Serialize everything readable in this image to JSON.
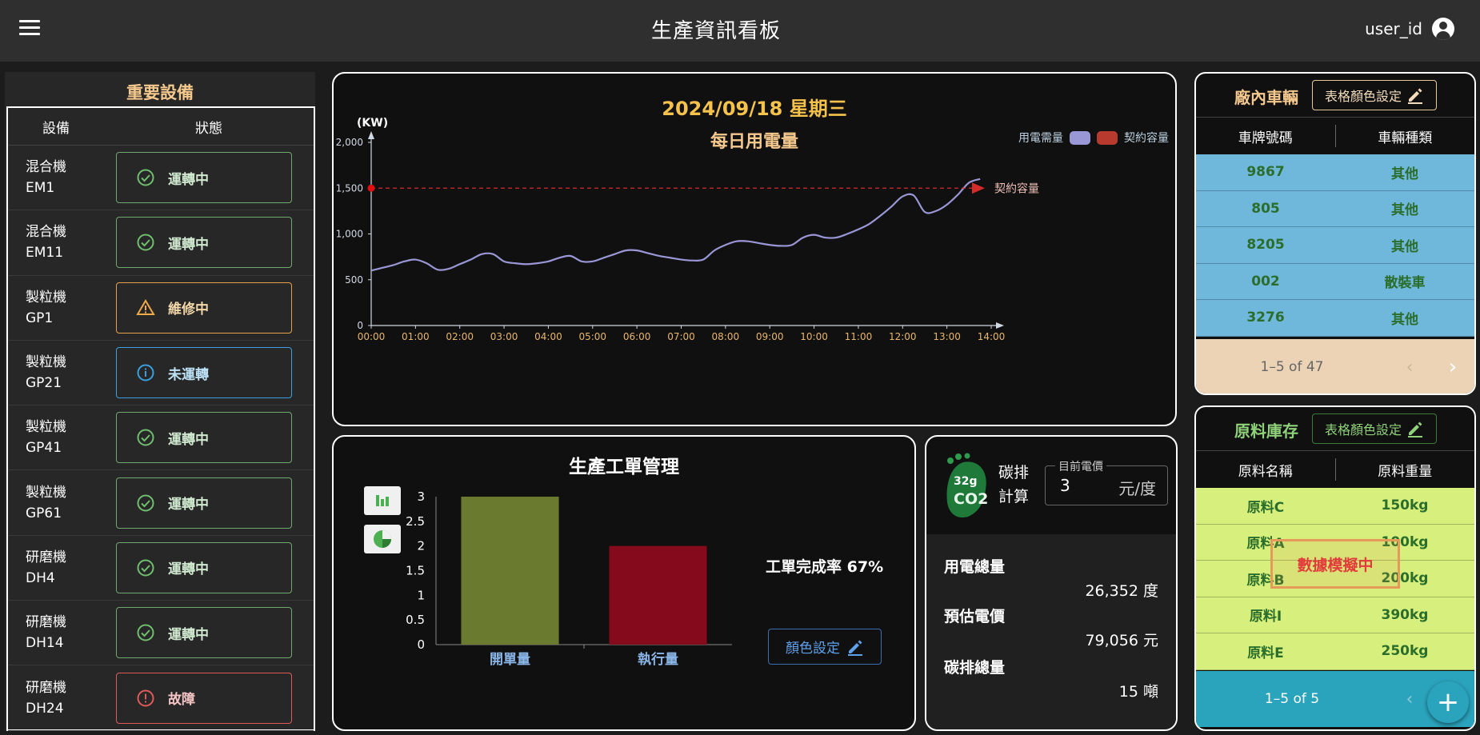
{
  "header": {
    "title": "生產資訊看板",
    "user": "user_id"
  },
  "equipment": {
    "title": "重要設備",
    "col_equipment": "設備",
    "col_status": "狀態",
    "items": [
      {
        "type": "混合機",
        "code": "EM1",
        "status": "運轉中",
        "kind": "ok"
      },
      {
        "type": "混合機",
        "code": "EM11",
        "status": "運轉中",
        "kind": "ok"
      },
      {
        "type": "製粒機",
        "code": "GP1",
        "status": "維修中",
        "kind": "warn"
      },
      {
        "type": "製粒機",
        "code": "GP21",
        "status": "未運轉",
        "kind": "info"
      },
      {
        "type": "製粒機",
        "code": "GP41",
        "status": "運轉中",
        "kind": "ok"
      },
      {
        "type": "製粒機",
        "code": "GP61",
        "status": "運轉中",
        "kind": "ok"
      },
      {
        "type": "研磨機",
        "code": "DH4",
        "status": "運轉中",
        "kind": "ok"
      },
      {
        "type": "研磨機",
        "code": "DH14",
        "status": "運轉中",
        "kind": "ok"
      },
      {
        "type": "研磨機",
        "code": "DH24",
        "status": "故障",
        "kind": "err"
      }
    ]
  },
  "power": {
    "date": "2024/09/18 星期三",
    "title": "每日用電量",
    "legend": [
      {
        "label": "用電需量",
        "color": "#9a97d6"
      },
      {
        "label": "契約容量",
        "color": "#b83a2e"
      }
    ],
    "contract_label": "契約容量",
    "chart_data": {
      "type": "line",
      "ylabel": "(KW)",
      "ylim": [
        0,
        2000
      ],
      "yticks": [
        "0",
        "500",
        "1,000",
        "1,500",
        "2,000"
      ],
      "xticks": [
        "00:00",
        "01:00",
        "02:00",
        "03:00",
        "04:00",
        "05:00",
        "06:00",
        "07:00",
        "08:00",
        "09:00",
        "10:00",
        "11:00",
        "12:00",
        "13:00",
        "14:00"
      ],
      "contract_capacity": 1500,
      "series": [
        {
          "name": "用電需量",
          "x": [
            0,
            0.25,
            0.5,
            0.75,
            1,
            1.25,
            1.5,
            1.75,
            2,
            2.25,
            2.5,
            2.75,
            3,
            3.25,
            3.5,
            3.75,
            4,
            4.25,
            4.5,
            4.75,
            5,
            5.25,
            5.5,
            5.75,
            6,
            6.25,
            6.5,
            6.75,
            7,
            7.25,
            7.5,
            7.75,
            8,
            8.25,
            8.5,
            8.75,
            9,
            9.25,
            9.5,
            9.75,
            10,
            10.25,
            10.5,
            10.75,
            11,
            11.25,
            11.5,
            11.75,
            12,
            12.25,
            12.5,
            12.75,
            13,
            13.25,
            13.5,
            13.75
          ],
          "values": [
            600,
            630,
            660,
            700,
            720,
            680,
            610,
            620,
            670,
            720,
            780,
            780,
            700,
            680,
            670,
            680,
            700,
            740,
            760,
            700,
            700,
            740,
            780,
            820,
            820,
            790,
            760,
            740,
            720,
            710,
            720,
            820,
            880,
            920,
            920,
            900,
            880,
            870,
            880,
            960,
            990,
            960,
            960,
            1000,
            1050,
            1110,
            1200,
            1300,
            1410,
            1420,
            1240,
            1250,
            1320,
            1430,
            1560,
            1600
          ]
        }
      ]
    }
  },
  "orders": {
    "title": "生產工單管理",
    "completion_label": "工單完成率",
    "completion_value": "67%",
    "color_button": "顏色設定",
    "chart_data": {
      "type": "bar",
      "categories": [
        "開單量",
        "執行量"
      ],
      "values": [
        3,
        2
      ],
      "colors": [
        "#6a7a2e",
        "#850a1c"
      ],
      "ylim": [
        0,
        3
      ],
      "yticks": [
        "0",
        "0.5",
        "1",
        "1.5",
        "2",
        "2.5",
        "3"
      ]
    }
  },
  "carbon": {
    "badge": "32g",
    "badge_text": "CO2",
    "label_line1": "碳排",
    "label_line2": "計算",
    "price_label": "目前電價",
    "price_value": "3",
    "price_unit": "元/度",
    "usage_label": "用電總量",
    "usage_value": "26,352 度",
    "cost_label": "預估電價",
    "cost_value": "79,056 元",
    "emission_label": "碳排總量",
    "emission_value": "15 噸"
  },
  "vehicles": {
    "title": "廠內車輛",
    "title_color": "#f5c88e",
    "button": "表格顏色設定",
    "col1": "車牌號碼",
    "col2": "車輛種類",
    "row_color": "#6fb8dc",
    "text_color": "#2b6e2b",
    "footer_color": "#ecd3b6",
    "rows": [
      {
        "plate": "9867",
        "kind": "其他"
      },
      {
        "plate": "805",
        "kind": "其他"
      },
      {
        "plate": "8205",
        "kind": "其他"
      },
      {
        "plate": "002",
        "kind": "散裝車"
      },
      {
        "plate": "3276",
        "kind": "其他"
      }
    ],
    "pagination": "1–5 of 47"
  },
  "materials": {
    "title": "原料庫存",
    "title_color": "#8fd27a",
    "button": "表格顏色設定",
    "col1": "原料名稱",
    "col2": "原料重量",
    "row_color": "#d7ef7c",
    "text_color": "#2b6e2b",
    "footer_color": "#2aa4bd",
    "rows": [
      {
        "name": "原料C",
        "weight": "150kg"
      },
      {
        "name": "原料A",
        "weight": "100kg"
      },
      {
        "name": "原料B",
        "weight": "200kg"
      },
      {
        "name": "原料I",
        "weight": "390kg"
      },
      {
        "name": "原料E",
        "weight": "250kg"
      }
    ],
    "pagination": "1–5 of 5",
    "simulating": "數據模擬中"
  }
}
